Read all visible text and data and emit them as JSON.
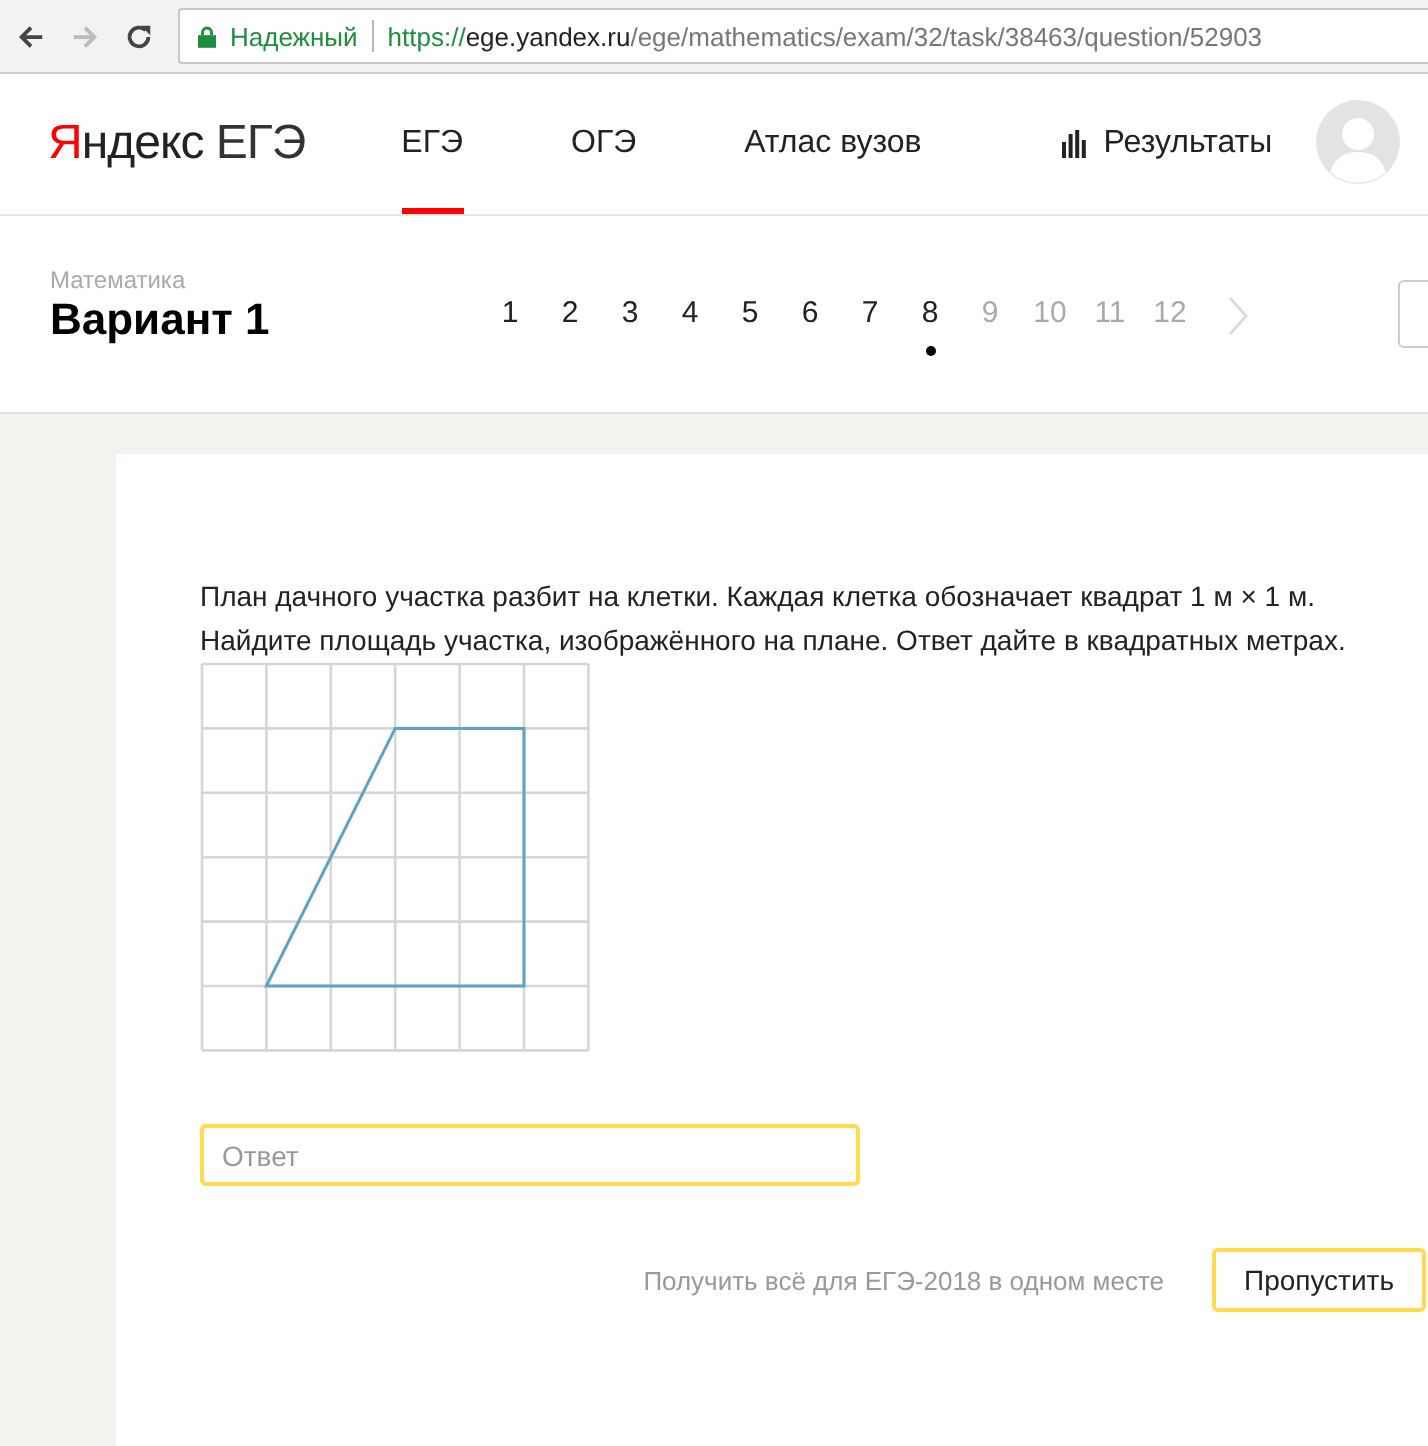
{
  "browser": {
    "security_label": "Надежный",
    "url": {
      "scheme": "https://",
      "host": "ege.yandex.ru",
      "path": "/ege/mathematics/exam/32/task/38463/question/52903"
    }
  },
  "header": {
    "logo": {
      "initial": "Я",
      "rest": "ндекс",
      "product": "ЕГЭ"
    },
    "nav": [
      {
        "label": "ЕГЭ",
        "selected": true,
        "kind": "plain"
      },
      {
        "label": "ОГЭ",
        "selected": false,
        "kind": "plain"
      },
      {
        "label": "Атлас вузов",
        "selected": false,
        "kind": "plain"
      },
      {
        "label": "Результаты",
        "selected": false,
        "kind": "stats"
      }
    ]
  },
  "test": {
    "subject": "Математика",
    "title": "Вариант 1",
    "pages": [
      {
        "label": "1",
        "visited": true,
        "selected": false
      },
      {
        "label": "2",
        "visited": true,
        "selected": false
      },
      {
        "label": "3",
        "visited": true,
        "selected": false
      },
      {
        "label": "4",
        "visited": true,
        "selected": false
      },
      {
        "label": "5",
        "visited": true,
        "selected": false
      },
      {
        "label": "6",
        "visited": true,
        "selected": false
      },
      {
        "label": "7",
        "visited": true,
        "selected": false
      },
      {
        "label": "8",
        "visited": true,
        "selected": true
      },
      {
        "label": "9",
        "visited": false,
        "selected": false
      },
      {
        "label": "10",
        "visited": false,
        "selected": false
      },
      {
        "label": "11",
        "visited": false,
        "selected": false
      },
      {
        "label": "12",
        "visited": false,
        "selected": false
      }
    ]
  },
  "task": {
    "text": "План дачного участка разбит на клетки. Каждая клетка обозначает квадрат 1 м × 1 м. Найдите площадь участка, изображённого на плане. Ответ дайте в квадратных метрах.",
    "answer": {
      "placeholder": "Ответ"
    },
    "promo_link": "Получить всё для ЕГЭ-2018 в одном месте",
    "skip_button": "Пропустить"
  }
}
